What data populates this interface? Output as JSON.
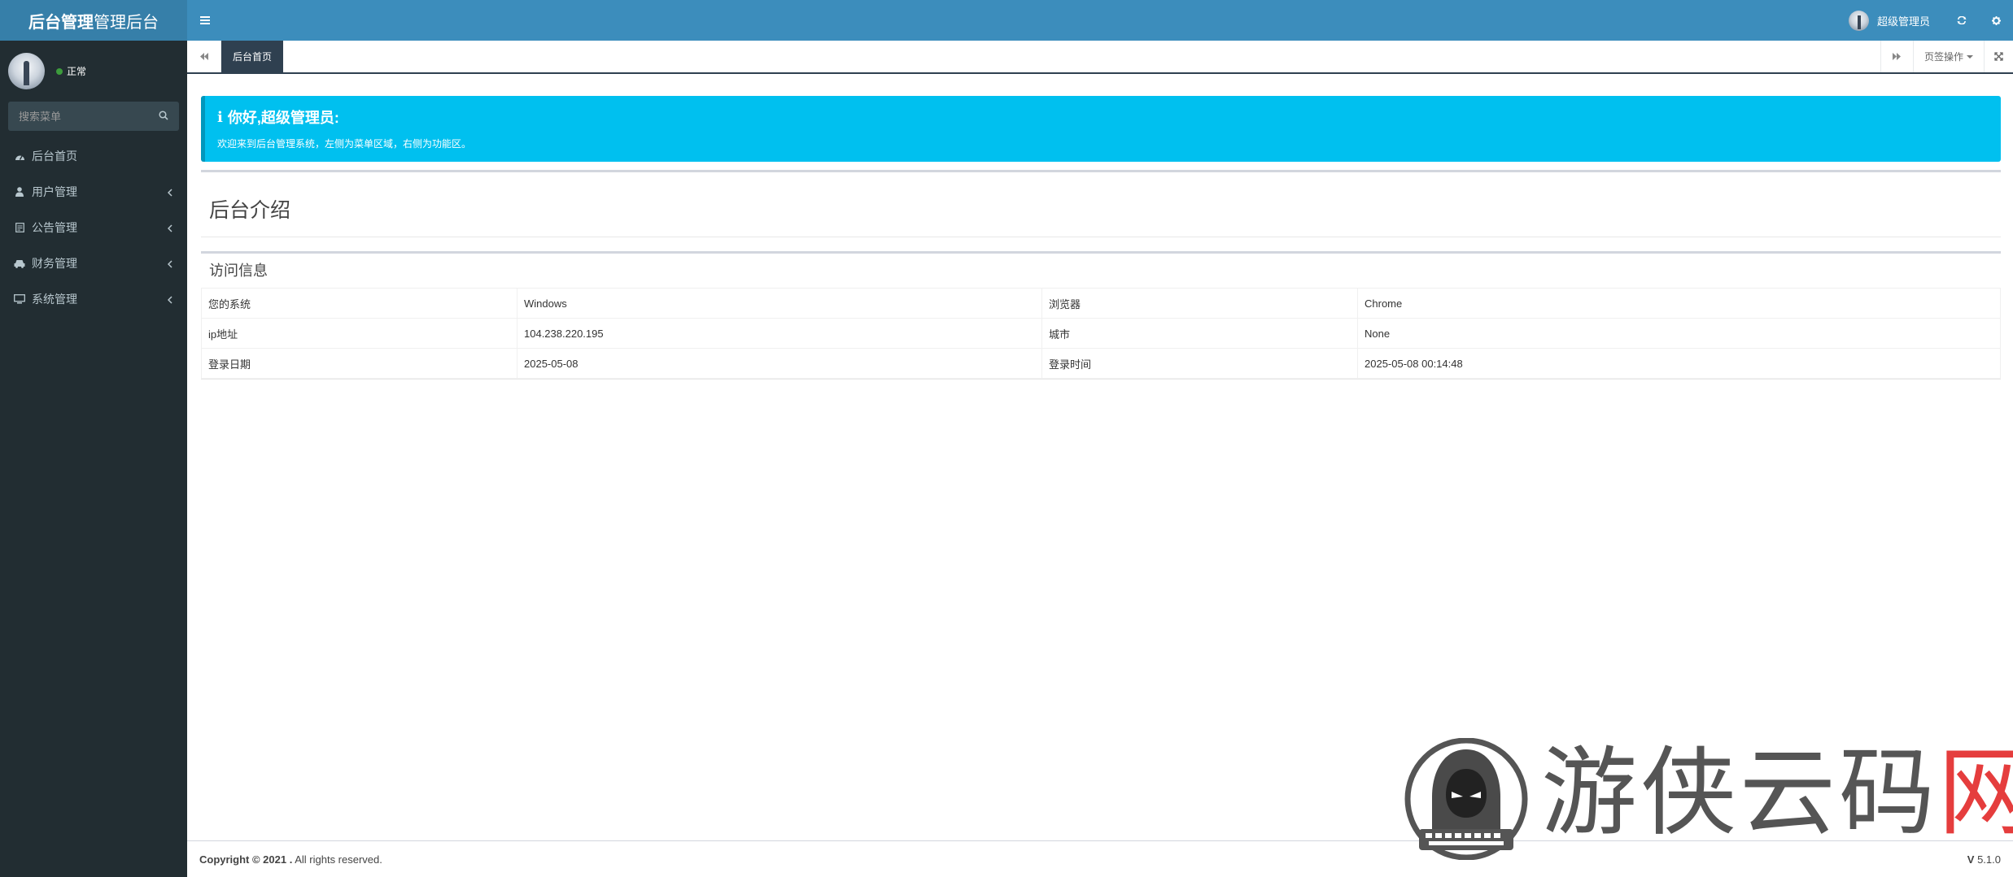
{
  "app": {
    "logo_bold": "后台管理",
    "logo_light": "管理后台"
  },
  "sidebar": {
    "status": "正常",
    "search_placeholder": "搜索菜单",
    "items": [
      {
        "label": "后台首页",
        "icon": "dashboard-icon"
      },
      {
        "label": "用户管理",
        "icon": "user-icon"
      },
      {
        "label": "公告管理",
        "icon": "notice-icon"
      },
      {
        "label": "财务管理",
        "icon": "car-icon"
      },
      {
        "label": "系统管理",
        "icon": "monitor-icon"
      }
    ]
  },
  "navbar": {
    "username": "超级管理员"
  },
  "tabs": {
    "active": "后台首页",
    "page_ops": "页签操作"
  },
  "callout": {
    "title": "你好,超级管理员:",
    "text": "欢迎来到后台管理系统，左侧为菜单区域，右侧为功能区。"
  },
  "intro": {
    "title": "后台介绍"
  },
  "visit": {
    "title": "访问信息",
    "rows": [
      [
        "您的系统",
        "Windows",
        "浏览器",
        "Chrome"
      ],
      [
        "ip地址",
        "104.238.220.195",
        "城市",
        "None"
      ],
      [
        "登录日期",
        "2025-05-08",
        "登录时间",
        "2025-05-08 00:14:48"
      ]
    ]
  },
  "footer": {
    "copyright_bold": "Copyright © 2021 .",
    "copyright_rest": " All rights reserved.",
    "version_bold": "V",
    "version": " 5.1.0"
  },
  "watermark": {
    "text_main": "游侠云码",
    "text_red": "网"
  },
  "colors": {
    "navbar": "#3c8dbc",
    "logo_bg": "#367fa9",
    "sidebar": "#222d32",
    "callout": "#00c0ef",
    "tab_active": "#2f4050"
  }
}
